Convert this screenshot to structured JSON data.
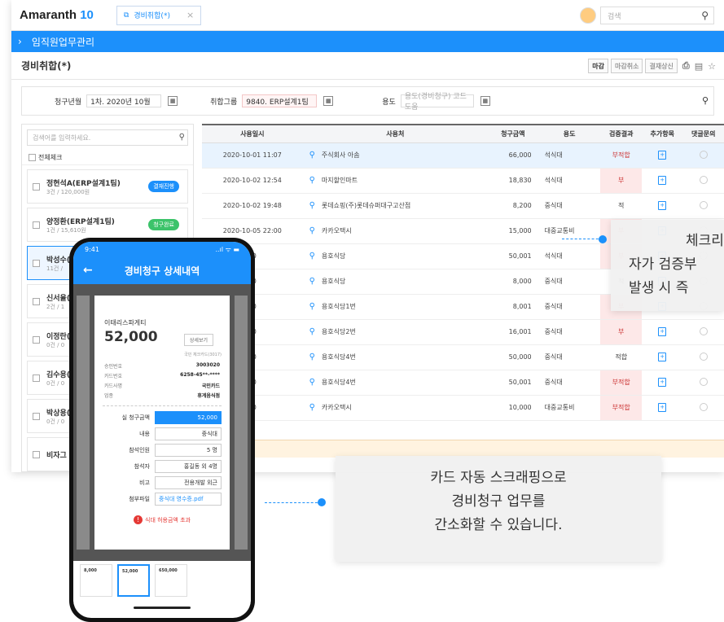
{
  "app": {
    "logo_text": "Amaranth",
    "logo_num": "10",
    "tab_label": "경비취합(*)",
    "search_placeholder": "검색"
  },
  "nav": {
    "breadcrumb": "임직원업무관리"
  },
  "page": {
    "title": "경비취합(*)",
    "buttons": [
      "마감",
      "마감취소",
      "결재상신"
    ]
  },
  "filter": {
    "period_label": "청구년월",
    "period_value": "1차. 2020년 10월",
    "group_label": "취합그룹",
    "group_value": "9840. ERP설계1팀",
    "usage_label": "용도",
    "usage_placeholder": "용도(경비청구) 코드도움"
  },
  "left": {
    "search_placeholder": "검색어를 입력하세요.",
    "check_all": "전체체크",
    "items": [
      {
        "name": "정현석A(ERP설계1팀)",
        "sub": "3건 / 120,000원",
        "badge": "결재진행",
        "badge_color": "#1c90fb"
      },
      {
        "name": "양정환(ERP설계1팀)",
        "sub": "1건 / 15,610원",
        "badge": "청구완료",
        "badge_color": "#3cc36a"
      },
      {
        "name": "박성수(",
        "sub": "11건 /",
        "badge": "",
        "badge_color": ""
      },
      {
        "name": "신서율(",
        "sub": "2건 / 1",
        "badge": "",
        "badge_color": ""
      },
      {
        "name": "이정란(",
        "sub": "0건 / 0",
        "badge": "",
        "badge_color": ""
      },
      {
        "name": "김수용(",
        "sub": "0건 / 0",
        "badge": "",
        "badge_color": ""
      },
      {
        "name": "박상용(",
        "sub": "0건 / 0",
        "badge": "",
        "badge_color": ""
      },
      {
        "name": "비자그",
        "sub": "",
        "badge": "",
        "badge_color": ""
      }
    ]
  },
  "table": {
    "headers": [
      "사용일시",
      "사용처",
      "청구금액",
      "용도",
      "검증결과",
      "추가항목",
      "댓글문의"
    ],
    "rows": [
      {
        "date": "2020-10-01 11:07",
        "place": "주식회사 아솜",
        "amount": "66,000",
        "use": "석식대",
        "result": "부적합"
      },
      {
        "date": "2020-10-02 12:54",
        "place": "마지할인마트",
        "amount": "18,830",
        "use": "석식대",
        "result": "부"
      },
      {
        "date": "2020-10-02 19:48",
        "place": "롯데쇼핑(주)롯데슈퍼대구고산점",
        "amount": "8,200",
        "use": "중식대",
        "result": "적"
      },
      {
        "date": "2020-10-05 22:00",
        "place": "카카오택시",
        "amount": "15,000",
        "use": "대중교통비",
        "result": "부"
      },
      {
        "date": "00",
        "place": "용호식당",
        "amount": "50,001",
        "use": "석식대",
        "result": "부"
      },
      {
        "date": "00",
        "place": "용호식당",
        "amount": "8,000",
        "use": "중식대",
        "result": "적"
      },
      {
        "date": "00",
        "place": "용호식당1번",
        "amount": "8,001",
        "use": "중식대",
        "result": "부"
      },
      {
        "date": "00",
        "place": "용호식당2번",
        "amount": "16,001",
        "use": "중식대",
        "result": "부"
      },
      {
        "date": "00",
        "place": "용호식당4번",
        "amount": "50,000",
        "use": "중식대",
        "result": "적합"
      },
      {
        "date": "00",
        "place": "용호식당4번",
        "amount": "50,001",
        "use": "중식대",
        "result": "부적합"
      },
      {
        "date": "00",
        "place": "카카오택시",
        "amount": "10,000",
        "use": "대중교통비",
        "result": "부적합"
      }
    ]
  },
  "callout1": {
    "line1": "체크리",
    "line2": "자가 검증부",
    "line3": "발생 시 즉"
  },
  "callout2": {
    "line1": "카드 자동 스크래핑으로",
    "line2": "경비청구 업무를",
    "line3": "간소화할 수 있습니다."
  },
  "phone": {
    "time": "9:41",
    "signal": "..ıl ᯤ ▬",
    "title": "경비청구 상세내역",
    "shop": "이태리스파게티",
    "amount": "52,000",
    "detail_btn": "상세보기",
    "tag": "국민 체크카드(3017)",
    "info": [
      {
        "k": "승인번호",
        "v": "3003020"
      },
      {
        "k": "카드번호",
        "v": "6258-45**-****"
      },
      {
        "k": "카드사명",
        "v": "국민카드"
      },
      {
        "k": "업종",
        "v": "휴게음식점"
      }
    ],
    "fields": [
      {
        "k": "실 청구금액",
        "v": "52,000"
      },
      {
        "k": "내용",
        "v": "중식대"
      },
      {
        "k": "참석인원",
        "v": "5 명"
      },
      {
        "k": "참석자",
        "v": "홍길동 외 4명"
      },
      {
        "k": "비고",
        "v": "전용개발 외근"
      },
      {
        "k": "첨부파일",
        "v": "중식대 영수증.pdf"
      }
    ],
    "warning": "식대 허용금액 초과",
    "thumbs": [
      "8,000",
      "52,000",
      "650,000"
    ]
  }
}
